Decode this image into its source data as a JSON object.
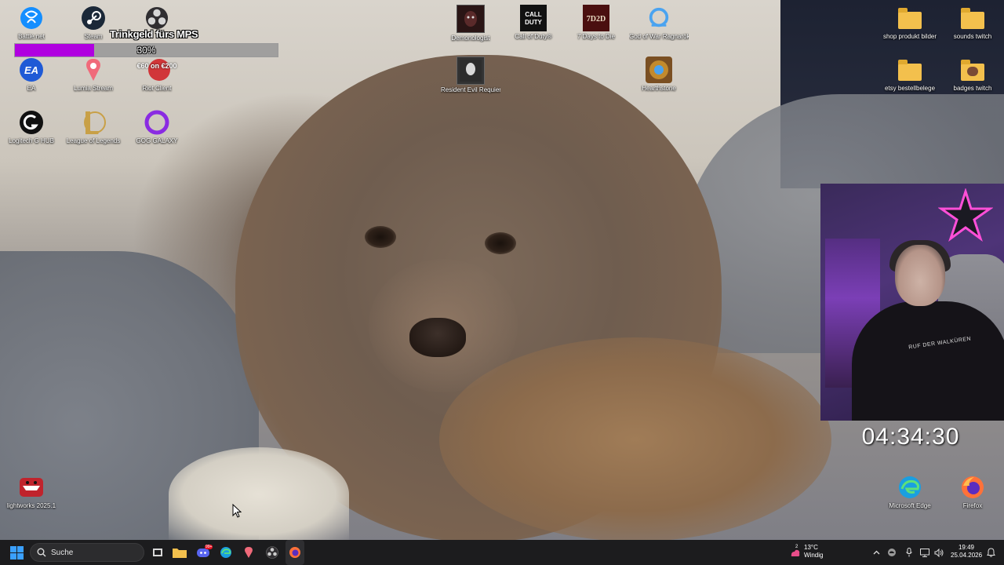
{
  "desktop": {
    "icons": [
      {
        "label": "Battle.net",
        "icon": "battlenet-icon",
        "color": "#148eff"
      },
      {
        "label": "Steam",
        "icon": "steam-icon",
        "color": "#1b2838"
      },
      {
        "label": "",
        "icon": "obs-icon",
        "color": "#302e31"
      },
      {
        "label": "Demonologist",
        "icon": "demonologist-icon",
        "color": "#3a1a1a"
      },
      {
        "label": "Call of Duty®",
        "icon": "call-of-duty-icon",
        "color": "#111111"
      },
      {
        "label": "7 Days to Die",
        "icon": "7-days-to-die-icon",
        "color": "#6a1212"
      },
      {
        "label": "God of War Ragnarök",
        "icon": "god-of-war-icon",
        "color": "#2c6fb0"
      },
      {
        "label": "EA",
        "icon": "ea-icon",
        "color": "#1f5ad6"
      },
      {
        "label": "Lumia Stream",
        "icon": "lumia-stream-icon",
        "color": "#f06a7a"
      },
      {
        "label": "Riot Client",
        "icon": "riot-client-icon",
        "color": "#d13639"
      },
      {
        "label": "Resident Evil Requiem",
        "icon": "resident-evil-icon",
        "color": "#444444"
      },
      {
        "label": "Hearthstone",
        "icon": "hearthstone-icon",
        "color": "#c28a2d"
      },
      {
        "label": "Logitech G HUB",
        "icon": "logitech-icon",
        "color": "#111111"
      },
      {
        "label": "League of Legends",
        "icon": "league-of-legends-icon",
        "color": "#c8a047"
      },
      {
        "label": "GOG GALAXY",
        "icon": "gog-galaxy-icon",
        "color": "#8a2be2"
      },
      {
        "label": "lightworks 2025.1",
        "icon": "lightworks-icon",
        "color": "#c0232c"
      },
      {
        "label": "Microsoft Edge",
        "icon": "edge-icon",
        "color": "#1a9fe0"
      },
      {
        "label": "Firefox",
        "icon": "firefox-icon",
        "color": "#ff7139"
      },
      {
        "label": "shop produkt bilder",
        "icon": "folder-icon",
        "color": "#f3c04d"
      },
      {
        "label": "sounds twitch",
        "icon": "folder-icon",
        "color": "#f3c04d"
      },
      {
        "label": "etsy bestellbelege",
        "icon": "folder-icon",
        "color": "#f3c04d"
      },
      {
        "label": "badges twitch",
        "icon": "folder-image-icon",
        "color": "#f3c04d"
      }
    ],
    "riot_overlay_text": "€60 on €200"
  },
  "tip_goal": {
    "title": "Trinkgeld fürs MPS",
    "percent_text": "30%",
    "progress": 0.3,
    "fill_color": "#b000e0"
  },
  "webcam": {
    "shirt_text": "RUF DER WALKÜREN"
  },
  "stream_clock": "04:34:30",
  "taskbar": {
    "search_placeholder": "Suche",
    "weather_temp": "13°C",
    "weather_desc": "Windig",
    "weather_badge": "2",
    "time": "19:49",
    "date": "25.04.2026",
    "discord_badge": "99+"
  }
}
